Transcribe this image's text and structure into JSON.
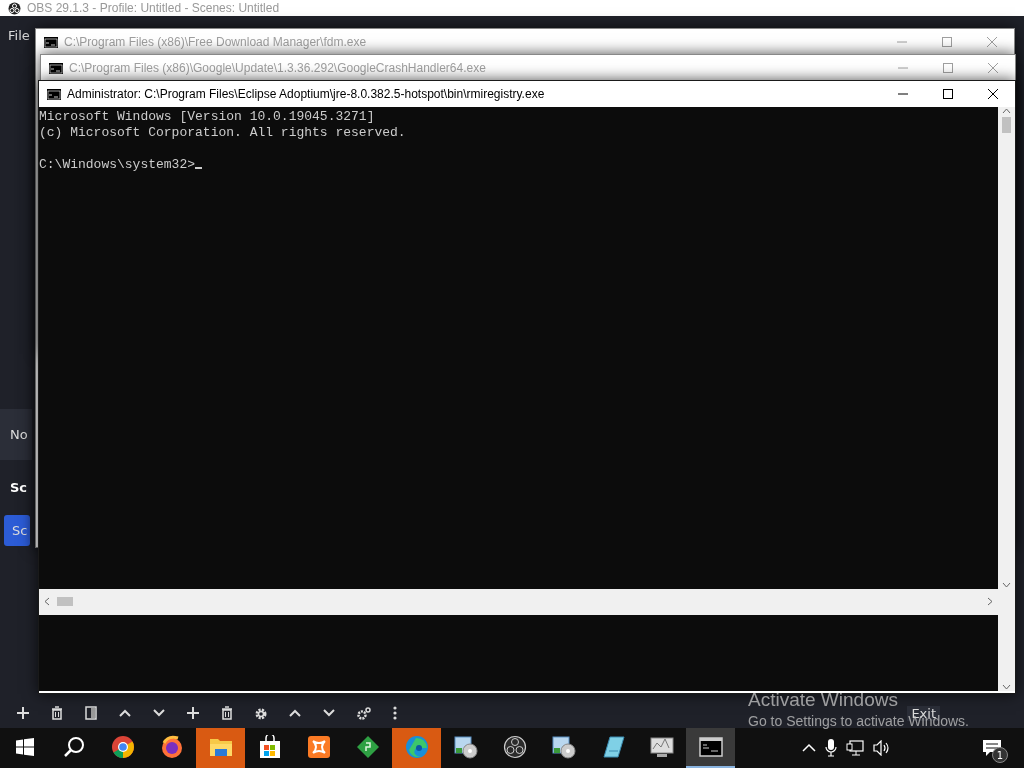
{
  "obs": {
    "title": "OBS 29.1.3 - Profile: Untitled - Scenes: Untitled",
    "menu": [
      "File"
    ],
    "docks": [
      {
        "label": "No",
        "kind": "tab"
      },
      {
        "label": "Sc",
        "kind": "header"
      },
      {
        "label": "Sc",
        "kind": "button"
      }
    ],
    "toolbar": [
      {
        "kind": "add"
      },
      {
        "kind": "remove"
      },
      {
        "kind": "filter"
      },
      {
        "kind": "up"
      },
      {
        "kind": "down"
      },
      {
        "kind": "add"
      },
      {
        "kind": "remove"
      },
      {
        "kind": "gear"
      },
      {
        "kind": "up"
      },
      {
        "kind": "down"
      },
      {
        "kind": "gears"
      },
      {
        "kind": "dots"
      }
    ],
    "exit_button": "Exit"
  },
  "windows": [
    {
      "title": "C:\\Program Files (x86)\\Free Download Manager\\fdm.exe",
      "active": false
    },
    {
      "title": "C:\\Program Files (x86)\\Google\\Update\\1.3.36.292\\GoogleCrashHandler64.exe",
      "active": false
    },
    {
      "title": "Administrator: C:\\Program Files\\Eclipse Adoptium\\jre-8.0.382.5-hotspot\\bin\\rmiregistry.exe",
      "active": true,
      "console": {
        "lines": [
          "Microsoft Windows [Version 10.0.19045.3271]",
          "(c) Microsoft Corporation. All rights reserved."
        ],
        "prompt": "C:\\Windows\\system32>"
      }
    }
  ],
  "activation": {
    "title": "Activate Windows",
    "message": "Go to Settings to activate Windows."
  },
  "taskbar": {
    "apps": [
      {
        "kind": "start",
        "flashing": false,
        "selected": false
      },
      {
        "kind": "search",
        "flashing": false,
        "selected": false
      },
      {
        "kind": "chrome",
        "flashing": false,
        "selected": false
      },
      {
        "kind": "firefox",
        "flashing": false,
        "selected": false
      },
      {
        "kind": "folder",
        "flashing": true,
        "selected": false
      },
      {
        "kind": "store",
        "flashing": false,
        "selected": false
      },
      {
        "kind": "xampp",
        "flashing": false,
        "selected": false
      },
      {
        "kind": "diamond",
        "flashing": false,
        "selected": false
      },
      {
        "kind": "edge",
        "flashing": true,
        "selected": false
      },
      {
        "kind": "disc",
        "flashing": false,
        "selected": false
      },
      {
        "kind": "obs",
        "flashing": false,
        "selected": false
      },
      {
        "kind": "disc",
        "flashing": false,
        "selected": false
      },
      {
        "kind": "notepad",
        "flashing": false,
        "selected": false
      },
      {
        "kind": "monitor",
        "flashing": false,
        "selected": false
      },
      {
        "kind": "console",
        "flashing": false,
        "selected": true
      }
    ],
    "tray": [
      {
        "kind": "chevron"
      },
      {
        "kind": "mic"
      },
      {
        "kind": "network"
      },
      {
        "kind": "speaker"
      }
    ],
    "notification_count": "1"
  }
}
